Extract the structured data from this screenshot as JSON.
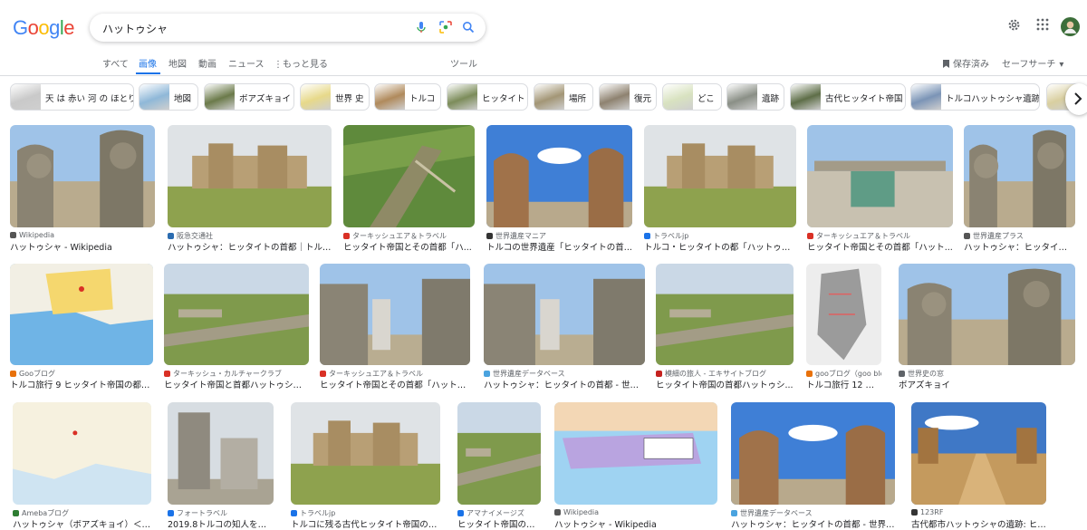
{
  "header": {
    "logo_letters": [
      "G",
      "o",
      "o",
      "g",
      "l",
      "e"
    ],
    "logo_colors": [
      "#4285f4",
      "#ea4335",
      "#fbbc05",
      "#4285f4",
      "#34a853",
      "#ea4335"
    ],
    "search_query": "ハットゥシャ",
    "icons": [
      "mic-icon",
      "lens-icon",
      "search-icon",
      "gear-icon",
      "apps-icon",
      "avatar"
    ]
  },
  "tabs": [
    {
      "label": "すべて",
      "active": false
    },
    {
      "label": "画像",
      "active": true
    },
    {
      "label": "地図",
      "active": false
    },
    {
      "label": "動画",
      "active": false
    },
    {
      "label": "ニュース",
      "active": false
    },
    {
      "label": "もっと見る",
      "active": false
    }
  ],
  "tools_label": "ツール",
  "saved_label": "保存済み",
  "safesearch_label": "セーフサーチ",
  "chips": [
    {
      "label": "天 は 赤い 河 の ほとり",
      "thumb": "#c9c9c9"
    },
    {
      "label": "地図",
      "thumb": "#8fb8d8"
    },
    {
      "label": "ボアズキョイ",
      "thumb": "#6b7a4a"
    },
    {
      "label": "世界 史",
      "thumb": "#e7d98a"
    },
    {
      "label": "トルコ",
      "thumb": "#b08a5c"
    },
    {
      "label": "ヒッタイト",
      "thumb": "#7c8c5a"
    },
    {
      "label": "場所",
      "thumb": "#a39676"
    },
    {
      "label": "復元",
      "thumb": "#8e8270"
    },
    {
      "label": "どこ",
      "thumb": "#d8e2c0"
    },
    {
      "label": "遺跡",
      "thumb": "#8a8f86"
    },
    {
      "label": "古代ヒッタイト帝国",
      "thumb": "#5e6e48"
    },
    {
      "label": "トルコハットゥシャ遺跡",
      "thumb": "#7b94b6"
    },
    {
      "label": "",
      "thumb": "#d9cfa0"
    }
  ],
  "results": [
    [
      {
        "source": "Wikipedia",
        "title": "ハットゥシャ - Wikipedia",
        "fav": "#555555",
        "kind": "lions"
      },
      {
        "source": "阪急交通社",
        "title": "ハットゥシャ：ヒッタイトの首都｜トルコ...",
        "fav": "#2b6cb0",
        "kind": "wall"
      },
      {
        "source": "ターキッシュエア＆トラベル",
        "title": "ヒッタイト帝国とその首都「ハ...",
        "fav": "#d93025",
        "kind": "aerial"
      },
      {
        "source": "世界遺産マニア",
        "title": "トルコの世界遺産「ヒッタイトの首...",
        "fav": "#333333",
        "kind": "lionsky"
      },
      {
        "source": "トラベルjp",
        "title": "トルコ・ヒッタイトの都「ハットゥシ...",
        "fav": "#1a73e8",
        "kind": "wall"
      },
      {
        "source": "ターキッシュエア＆トラベル",
        "title": "ヒッタイト帝国とその首都「ハット...",
        "fav": "#d93025",
        "kind": "stone"
      },
      {
        "source": "世界遺産プラス",
        "title": "ハットゥシャ：ヒッタイト...",
        "fav": "#555555",
        "kind": "lions"
      }
    ],
    [
      {
        "source": "Gooブログ",
        "title": "トルコ旅行 9 ヒッタイト帝国の都「...",
        "fav": "#e8710a",
        "kind": "map"
      },
      {
        "source": "ターキッシュ・カルチャークラブ",
        "title": "ヒッタイト帝国と首都ハットゥシャ...",
        "fav": "#d93025",
        "kind": "ruins"
      },
      {
        "source": "ターキッシュエア＆トラベル",
        "title": "ヒッタイト帝国とその首都「ハットゥ...",
        "fav": "#d93025",
        "kind": "gate"
      },
      {
        "source": "世界遺産データベース",
        "title": "ハットゥシャ：ヒッタイトの首都 - 世界...",
        "fav": "#4aa3df",
        "kind": "gate"
      },
      {
        "source": "模細の旅人 - エキサイトブログ",
        "title": "ヒッタイト帝国の首都ハットゥシ...",
        "fav": "#c5221f",
        "kind": "ruins"
      },
      {
        "source": "gooブログ（goo blo...",
        "title": "トルコ旅行 12 ヒッ...",
        "fav": "#e8710a",
        "kind": "plan"
      },
      {
        "source": "世界史の窓",
        "title": "ボアズキョイ",
        "fav": "#5f6368",
        "kind": "lions"
      }
    ],
    [
      {
        "source": "Amebaブログ",
        "title": "ハットゥシャ（ボアズキョイ）＜ヒ...",
        "fav": "#2e7d32",
        "kind": "map2"
      },
      {
        "source": "フォートラベル",
        "title": "2019.8トルコの知人を訪ね...",
        "fav": "#1a73e8",
        "kind": "statue"
      },
      {
        "source": "トラベルjp",
        "title": "トルコに残る古代ヒッタイト帝国の足...",
        "fav": "#1a73e8",
        "kind": "wall"
      },
      {
        "source": "アマナイメージズ",
        "title": "ヒッタイト帝国のハ...",
        "fav": "#1a73e8",
        "kind": "ruins"
      },
      {
        "source": "Wikipedia",
        "title": "ハットゥシャ - Wikipedia",
        "fav": "#555555",
        "kind": "map3"
      },
      {
        "source": "世界遺産データベース",
        "title": "ハットゥシャ：ヒッタイトの首都 - 世界遺...",
        "fav": "#4aa3df",
        "kind": "lionsky"
      },
      {
        "source": "123RF",
        "title": "古代都市ハットゥシャの遺跡: ヒッタイト...",
        "fav": "#333333",
        "kind": "road"
      }
    ]
  ]
}
